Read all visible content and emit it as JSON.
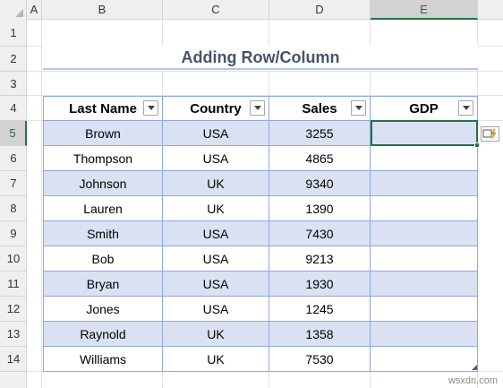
{
  "columns": [
    "A",
    "B",
    "C",
    "D",
    "E"
  ],
  "selected_column": "E",
  "rows": [
    "1",
    "2",
    "3",
    "4",
    "5",
    "6",
    "7",
    "8",
    "9",
    "10",
    "11",
    "12",
    "13",
    "14"
  ],
  "selected_row": "5",
  "title": "Adding Row/Column",
  "table": {
    "headers": [
      "Last Name",
      "Country",
      "Sales",
      "GDP"
    ],
    "rows": [
      [
        "Brown",
        "USA",
        "3255",
        ""
      ],
      [
        "Thompson",
        "USA",
        "4865",
        ""
      ],
      [
        "Johnson",
        "UK",
        "9340",
        ""
      ],
      [
        "Lauren",
        "UK",
        "1390",
        ""
      ],
      [
        "Smith",
        "USA",
        "7430",
        ""
      ],
      [
        "Bob",
        "USA",
        "9213",
        ""
      ],
      [
        "Bryan",
        "USA",
        "1930",
        ""
      ],
      [
        "Jones",
        "USA",
        "1245",
        ""
      ],
      [
        "Raynold",
        "UK",
        "1358",
        ""
      ],
      [
        "Williams",
        "UK",
        "7530",
        ""
      ]
    ]
  },
  "quick_analysis_icon": "autocorrect-options-icon",
  "watermark": "wsxdn.com",
  "colors": {
    "accent": "#217346",
    "band": "#d9e1f2",
    "border": "#8ea9db",
    "title": "#44546a"
  }
}
